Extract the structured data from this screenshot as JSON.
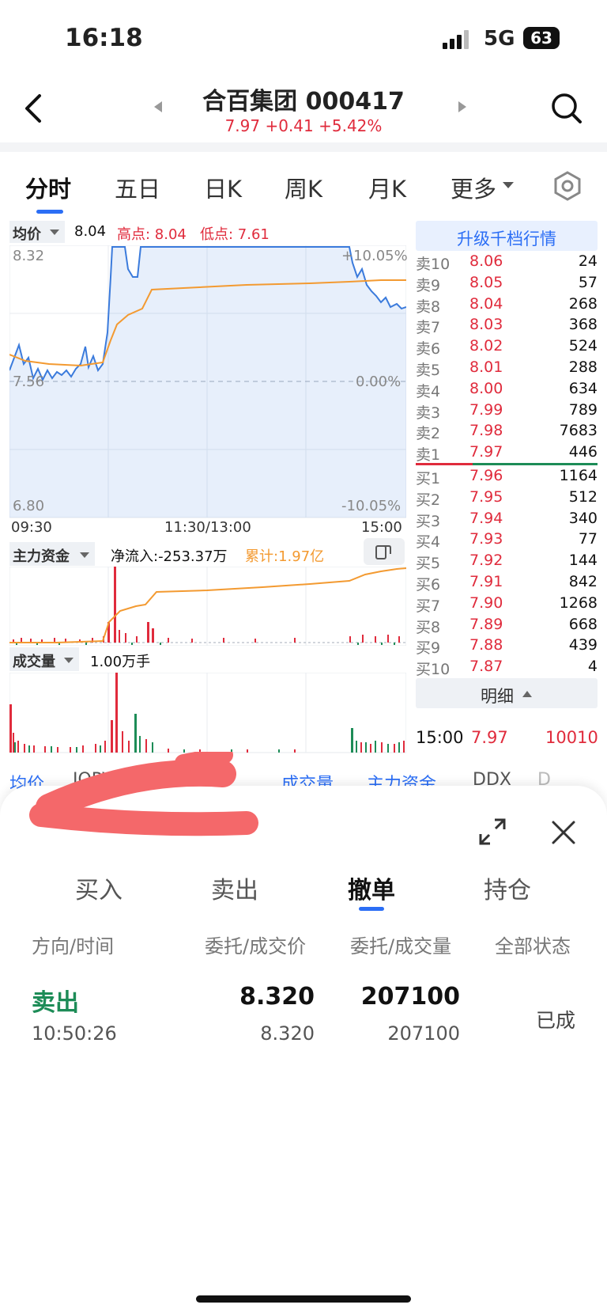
{
  "status_bar": {
    "time": "16:18",
    "network": "5G",
    "battery": "63"
  },
  "header": {
    "title": "合百集团 000417",
    "price_line": "7.97 +0.41 +5.42%"
  },
  "tabs": [
    "分时",
    "五日",
    "日K",
    "周K",
    "月K",
    "更多"
  ],
  "main_chart": {
    "avg_label": "均价",
    "avg_value": "8.04",
    "high_text": "高点: 8.04",
    "low_text": "低点: 7.61",
    "y_top": "8.32",
    "y_mid": "7.56",
    "y_bottom": "6.80",
    "pct_top": "+10.05%",
    "pct_mid": "0.00%",
    "pct_bottom": "-10.05%",
    "x_start": "09:30",
    "x_mid": "11:30/13:00",
    "x_end": "15:00",
    "price_color": "#3b7bdc",
    "avg_color": "#f39a31"
  },
  "capital": {
    "label": "主力资金",
    "net_inflow": "净流入:-253.37万",
    "cumulative": "累计:1.97亿"
  },
  "volume": {
    "label": "成交量",
    "value": "1.00万手"
  },
  "indicator_tabs": [
    "均价",
    "IOPV",
    "神奇九转",
    "成交量",
    "主力资金",
    "DDX",
    "D"
  ],
  "order_book": {
    "upgrade_label": "升级千档行情",
    "asks": [
      {
        "k": "卖10",
        "p": "8.06",
        "q": "24"
      },
      {
        "k": "卖9",
        "p": "8.05",
        "q": "57"
      },
      {
        "k": "卖8",
        "p": "8.04",
        "q": "268"
      },
      {
        "k": "卖7",
        "p": "8.03",
        "q": "368"
      },
      {
        "k": "卖6",
        "p": "8.02",
        "q": "524"
      },
      {
        "k": "卖5",
        "p": "8.01",
        "q": "288"
      },
      {
        "k": "卖4",
        "p": "8.00",
        "q": "634"
      },
      {
        "k": "卖3",
        "p": "7.99",
        "q": "789"
      },
      {
        "k": "卖2",
        "p": "7.98",
        "q": "7683"
      },
      {
        "k": "卖1",
        "p": "7.97",
        "q": "446"
      }
    ],
    "bids": [
      {
        "k": "买1",
        "p": "7.96",
        "q": "1164"
      },
      {
        "k": "买2",
        "p": "7.95",
        "q": "512"
      },
      {
        "k": "买3",
        "p": "7.94",
        "q": "340"
      },
      {
        "k": "买4",
        "p": "7.93",
        "q": "77"
      },
      {
        "k": "买5",
        "p": "7.92",
        "q": "144"
      },
      {
        "k": "买6",
        "p": "7.91",
        "q": "842"
      },
      {
        "k": "买7",
        "p": "7.90",
        "q": "1268"
      },
      {
        "k": "买8",
        "p": "7.89",
        "q": "668"
      },
      {
        "k": "买9",
        "p": "7.88",
        "q": "439"
      },
      {
        "k": "买10",
        "p": "7.87",
        "q": "4"
      }
    ],
    "detail_label": "明细",
    "last_trade": {
      "time": "15:00",
      "price": "7.97",
      "qty": "10010"
    }
  },
  "trade_sheet": {
    "tabs": [
      "买入",
      "卖出",
      "撤单",
      "持仓"
    ],
    "active_tab": "撤单",
    "columns": [
      "方向/时间",
      "委托/成交价",
      "委托/成交量",
      "全部状态"
    ],
    "orders": [
      {
        "direction": "卖出",
        "time": "10:50:26",
        "order_price": "8.320",
        "deal_price": "8.320",
        "order_qty": "207100",
        "deal_qty": "207100",
        "status": "已成"
      }
    ]
  }
}
